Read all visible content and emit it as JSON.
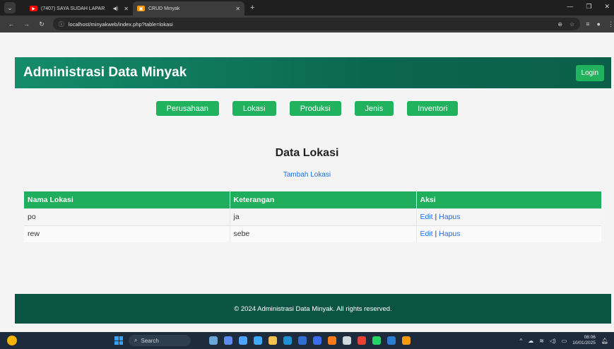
{
  "browser": {
    "tabs": [
      {
        "title": "(7407) SAYA SUDAH LAPAR",
        "favicon": "youtube-icon",
        "audio": true
      },
      {
        "title": "CRUD Minyak",
        "favicon": "crud-icon",
        "active": true
      }
    ],
    "url": "localhost/minyakweb/index.php?table=lokasi"
  },
  "header": {
    "title": "Administrasi Data Minyak",
    "login_label": "Login"
  },
  "nav": [
    "Perusahaan",
    "Lokasi",
    "Produksi",
    "Jenis",
    "Inventori"
  ],
  "main": {
    "title": "Data Lokasi",
    "add_link": "Tambah Lokasi",
    "table": {
      "columns": [
        "Nama Lokasi",
        "Keterangan",
        "Aksi"
      ],
      "rows": [
        {
          "nama": "po",
          "keterangan": "ja",
          "edit": "Edit",
          "hapus": "Hapus"
        },
        {
          "nama": "rew",
          "keterangan": "sebe",
          "edit": "Edit",
          "hapus": "Hapus"
        }
      ],
      "separator": "|"
    }
  },
  "footer": {
    "text": "© 2024 Administrasi Data Minyak. All rights reserved."
  },
  "taskbar": {
    "search_placeholder": "Search",
    "time": "08:06",
    "date": "10/01/2025"
  },
  "colors": {
    "header_start": "#148c6a",
    "header_end": "#0b5f48",
    "button_green": "#20b25d",
    "table_header": "#1fae5c",
    "footer": "#0b5444",
    "link": "#1a73e8"
  }
}
